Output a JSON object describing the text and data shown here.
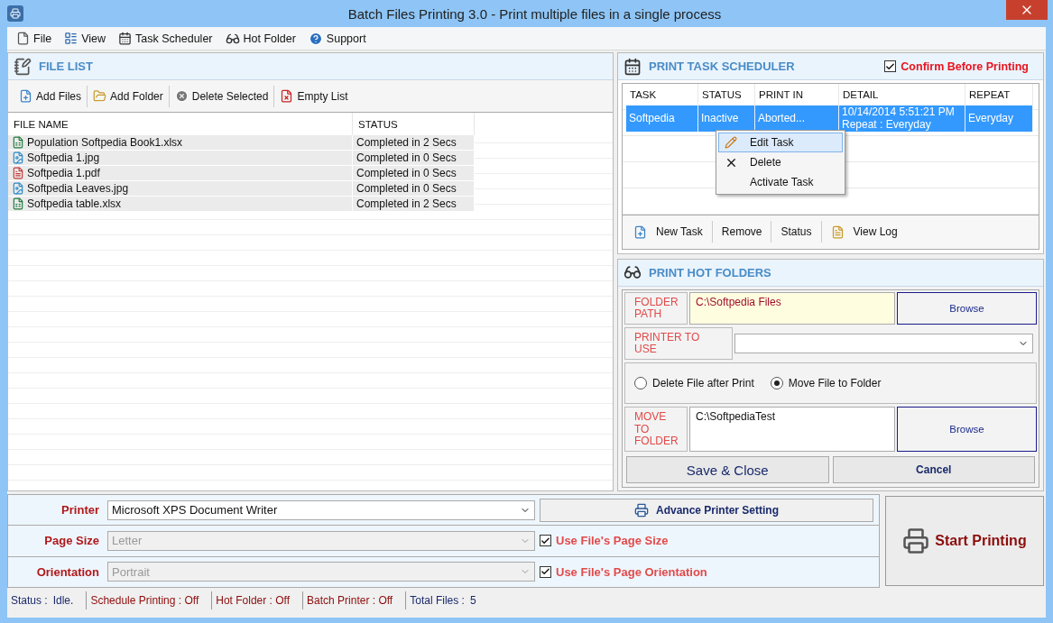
{
  "window": {
    "title": "Batch Files Printing 3.0 - Print multiple files in a single process"
  },
  "menu": [
    {
      "label": "File",
      "kind": "file"
    },
    {
      "label": "View",
      "kind": "list"
    },
    {
      "label": "Task Scheduler",
      "kind": "calendar"
    },
    {
      "label": "Hot Folder",
      "kind": "glasses"
    },
    {
      "label": "Support",
      "kind": "help"
    }
  ],
  "file_list": {
    "title": "FILE LIST",
    "toolbar": [
      {
        "label": "Add Files",
        "kind": "add"
      },
      {
        "label": "Add Folder",
        "kind": "folder"
      },
      {
        "label": "Delete Selected",
        "kind": "delete"
      },
      {
        "label": "Empty List",
        "kind": "clear"
      }
    ],
    "columns": [
      "FILE NAME",
      "STATUS"
    ],
    "rows": [
      {
        "name": "Population Softpedia Book1.xlsx",
        "status": "Completed in 2 Secs",
        "kind": "spreadsheet"
      },
      {
        "name": "Softpedia 1.jpg",
        "status": "Completed in 0 Secs",
        "kind": "image"
      },
      {
        "name": "Softpedia 1.pdf",
        "status": "Completed in 0 Secs",
        "kind": "pdf"
      },
      {
        "name": "Softpedia Leaves.jpg",
        "status": "Completed in 0 Secs",
        "kind": "image"
      },
      {
        "name": "Softpedia table.xlsx",
        "status": "Completed in 2 Secs",
        "kind": "spreadsheet"
      }
    ]
  },
  "scheduler": {
    "title": "PRINT TASK SCHEDULER",
    "confirm": {
      "label": "Confirm Before Printing",
      "checked": true
    },
    "columns": [
      "TASK",
      "STATUS",
      "PRINT IN",
      "DETAIL",
      "REPEAT"
    ],
    "rows": [
      {
        "cells": [
          "Softpedia",
          "Inactive",
          "Aborted...",
          "10/14/2014 5:51:21 PM Repeat : Everyday",
          "Everyday"
        ],
        "selected": true
      }
    ],
    "context_menu": [
      {
        "label": "Edit Task",
        "kind": "edit",
        "selected": true
      },
      {
        "label": "Delete",
        "kind": "remove",
        "selected": false
      },
      {
        "label": "Activate Task",
        "kind": "plain",
        "selected": false
      }
    ],
    "toolbar": [
      {
        "label": "New Task",
        "kind": "add"
      },
      {
        "label": "Remove",
        "kind": "plain"
      },
      {
        "label": "Status",
        "kind": "plain"
      },
      {
        "label": "View Log",
        "kind": "log"
      }
    ]
  },
  "hot_folders": {
    "title": "PRINT HOT FOLDERS",
    "folder_path": {
      "label": "FOLDER PATH",
      "value": "C:\\Softpedia Files",
      "button": "Browse"
    },
    "printer_to_use": {
      "label": "PRINTER TO USE"
    },
    "options": [
      {
        "label": "Delete File after Print",
        "selected": false
      },
      {
        "label": "Move File to Folder",
        "selected": true
      }
    ],
    "move_to_folder": {
      "label": "MOVE TO FOLDER",
      "value": "C:\\SoftpediaTest",
      "button": "Browse"
    },
    "buttons": [
      {
        "label": "Save & Close",
        "kind": "large"
      },
      {
        "label": "Cancel",
        "kind": "bold"
      }
    ]
  },
  "print_settings": {
    "rows": [
      {
        "label": "Printer",
        "value": "Microsoft XPS Document Writer",
        "disabled": false,
        "extra": {
          "kind": "button",
          "label": "Advance Printer Setting"
        }
      },
      {
        "label": "Page Size",
        "value": "Letter",
        "disabled": true,
        "extra": {
          "kind": "checkbox",
          "label": "Use File's Page Size",
          "checked": true
        }
      },
      {
        "label": "Orientation",
        "value": "Portrait",
        "disabled": true,
        "extra": {
          "kind": "checkbox",
          "label": "Use File's Page Orientation",
          "checked": true
        }
      }
    ],
    "start_button": "Start Printing"
  },
  "status_bar": [
    {
      "label": "Status :",
      "value": "Idle.",
      "kind": "plain"
    },
    {
      "label": "Schedule Printing : Off",
      "kind": "red"
    },
    {
      "label": "Hot Folder : Off",
      "kind": "red"
    },
    {
      "label": "Batch Printer : Off",
      "kind": "red"
    },
    {
      "label": "Total Files :",
      "value": "5",
      "kind": "plain"
    }
  ]
}
